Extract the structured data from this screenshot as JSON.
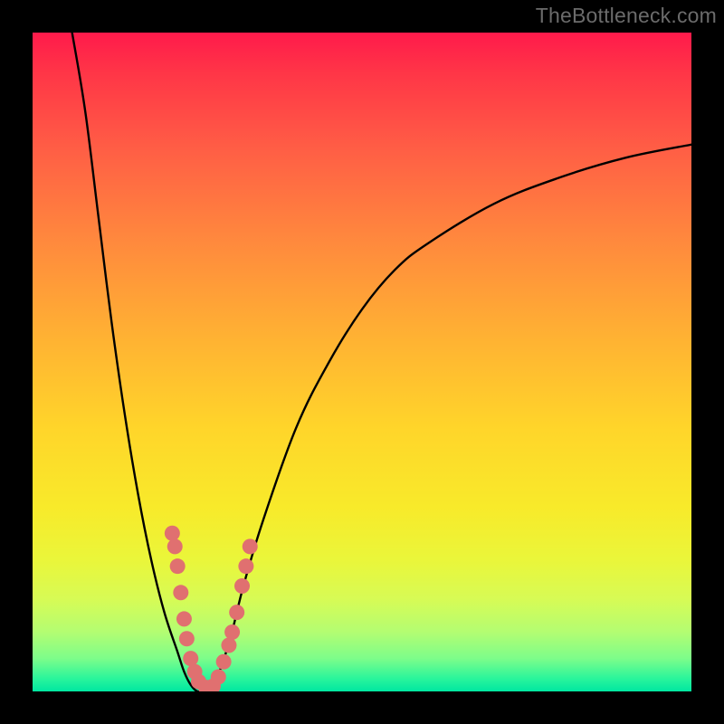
{
  "watermark": "TheBottleneck.com",
  "colors": {
    "background_frame": "#000000",
    "curve": "#000000",
    "marker": "#e07070",
    "gradient_top": "#ff1a4b",
    "gradient_bottom": "#00e7a1"
  },
  "chart_data": {
    "type": "line",
    "title": "",
    "xlabel": "",
    "ylabel": "",
    "xlim": [
      0,
      100
    ],
    "ylim": [
      0,
      100
    ],
    "note": "Two curves forming a V against a vertical red→green gradient. Y appears to represent bottleneck severity (high = red/bad, low = green/good). Pink markers cluster near the valley on both branches.",
    "series": [
      {
        "name": "left-branch",
        "x": [
          6,
          8,
          10,
          12,
          14,
          16,
          18,
          20,
          22,
          23,
          24,
          25,
          26
        ],
        "values": [
          100,
          88,
          72,
          56,
          42,
          30,
          20,
          12,
          6,
          3,
          1,
          0,
          0
        ]
      },
      {
        "name": "right-branch",
        "x": [
          26,
          27,
          28,
          30,
          32,
          35,
          40,
          45,
          50,
          55,
          60,
          70,
          80,
          90,
          100
        ],
        "values": [
          0,
          0,
          2,
          8,
          16,
          26,
          40,
          50,
          58,
          64,
          68,
          74,
          78,
          81,
          83
        ]
      }
    ],
    "markers": [
      {
        "series": "left-branch",
        "x": 21.2,
        "y": 24
      },
      {
        "series": "left-branch",
        "x": 21.6,
        "y": 22
      },
      {
        "series": "left-branch",
        "x": 22.0,
        "y": 19
      },
      {
        "series": "left-branch",
        "x": 22.5,
        "y": 15
      },
      {
        "series": "left-branch",
        "x": 23.0,
        "y": 11
      },
      {
        "series": "left-branch",
        "x": 23.4,
        "y": 8
      },
      {
        "series": "left-branch",
        "x": 24.0,
        "y": 5
      },
      {
        "series": "left-branch",
        "x": 24.6,
        "y": 3
      },
      {
        "series": "left-branch",
        "x": 25.2,
        "y": 1.5
      },
      {
        "series": "left-branch",
        "x": 26.3,
        "y": 0.6
      },
      {
        "series": "right-branch",
        "x": 27.4,
        "y": 0.8
      },
      {
        "series": "right-branch",
        "x": 28.2,
        "y": 2.2
      },
      {
        "series": "right-branch",
        "x": 29.0,
        "y": 4.5
      },
      {
        "series": "right-branch",
        "x": 29.8,
        "y": 7
      },
      {
        "series": "right-branch",
        "x": 30.3,
        "y": 9
      },
      {
        "series": "right-branch",
        "x": 31.0,
        "y": 12
      },
      {
        "series": "right-branch",
        "x": 31.8,
        "y": 16
      },
      {
        "series": "right-branch",
        "x": 32.4,
        "y": 19
      },
      {
        "series": "right-branch",
        "x": 33.0,
        "y": 22
      }
    ]
  }
}
